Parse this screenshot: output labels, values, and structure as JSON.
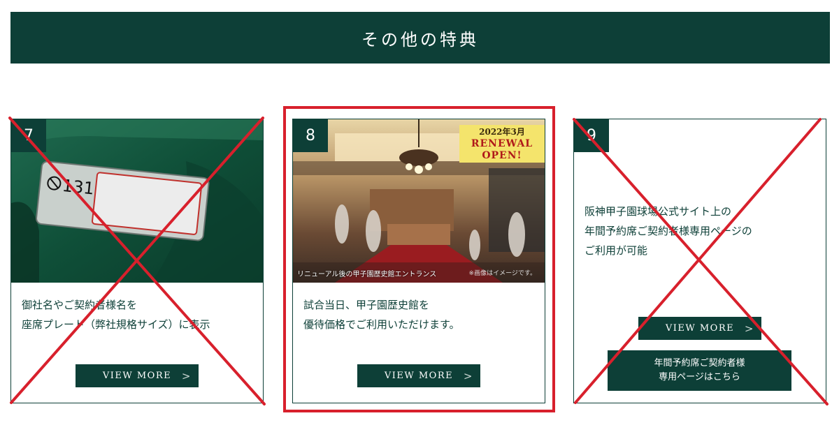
{
  "section": {
    "title": "その他の特典"
  },
  "cards": [
    {
      "number": "7",
      "image": {
        "plate_number": "131",
        "icon": "no-smoking-icon"
      },
      "description": [
        "御社名やご契約者様名を",
        "座席プレート（弊社規格サイズ）に表示"
      ],
      "view_more": "VIEW MORE",
      "arrow": ">",
      "crossed_out": true
    },
    {
      "number": "8",
      "image": {
        "badge_date": "2022年3月",
        "badge_line2": "RENEWAL",
        "badge_line3": "OPEN!",
        "caption": "リニューアル後の甲子園歴史館エントランス",
        "note": "※画像はイメージです。"
      },
      "description": [
        "試合当日、甲子園歴史館を",
        "優待価格でご利用いただけます。"
      ],
      "view_more": "VIEW MORE",
      "arrow": ">",
      "highlighted": true
    },
    {
      "number": "9",
      "description": [
        "阪神甲子園球場公式サイト上の",
        "年間予約席ご契約者様専用ページの",
        "ご利用が可能"
      ],
      "view_more": "VIEW MORE",
      "arrow": ">",
      "reserve_button": [
        "年間予約席ご契約者様",
        "専用ページはこちら"
      ],
      "crossed_out": true
    }
  ],
  "colors": {
    "brand": "#0d3f37",
    "highlight": "#d8202c",
    "cross": "#d8202c",
    "badge": "#f4e46c"
  }
}
